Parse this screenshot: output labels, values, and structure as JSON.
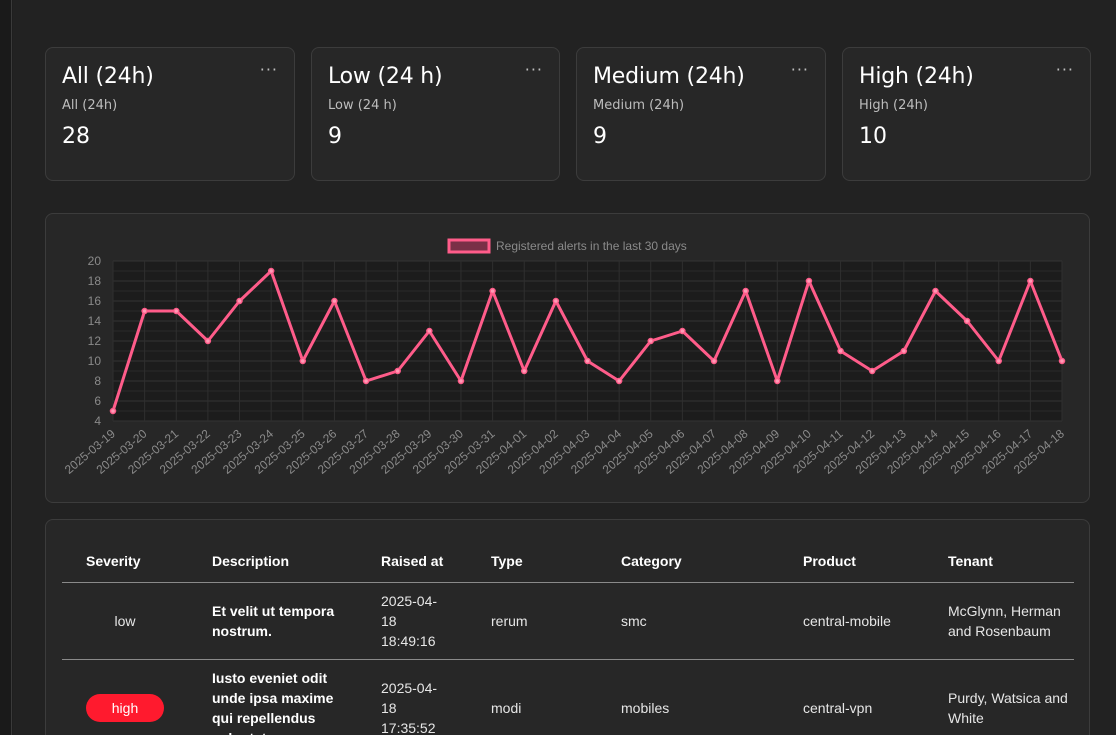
{
  "stats": [
    {
      "title": "All (24h)",
      "subtitle": "All (24h)",
      "value": "28"
    },
    {
      "title": "Low (24 h)",
      "subtitle": "Low (24 h)",
      "value": "9"
    },
    {
      "title": "Medium (24h)",
      "subtitle": "Medium (24h)",
      "value": "9"
    },
    {
      "title": "High (24h)",
      "subtitle": "High (24h)",
      "value": "10"
    }
  ],
  "menu_glyph": "···",
  "chart_data": {
    "type": "line",
    "legend_label": "Registered alerts in the last 30 days",
    "legend_placement": "top-center",
    "series_color": "#ff5c8a",
    "grid": true,
    "ylim": [
      4,
      20
    ],
    "yticks": [
      "20",
      "18",
      "16",
      "14",
      "12",
      "10",
      "8",
      "6",
      "4"
    ],
    "categories": [
      "2025-03-19",
      "2025-03-20",
      "2025-03-21",
      "2025-03-22",
      "2025-03-23",
      "2025-03-24",
      "2025-03-25",
      "2025-03-26",
      "2025-03-27",
      "2025-03-28",
      "2025-03-29",
      "2025-03-30",
      "2025-03-31",
      "2025-04-01",
      "2025-04-02",
      "2025-04-03",
      "2025-04-04",
      "2025-04-05",
      "2025-04-06",
      "2025-04-07",
      "2025-04-08",
      "2025-04-09",
      "2025-04-10",
      "2025-04-11",
      "2025-04-12",
      "2025-04-13",
      "2025-04-14",
      "2025-04-15",
      "2025-04-16",
      "2025-04-17",
      "2025-04-18"
    ],
    "values": [
      5,
      15,
      15,
      12,
      16,
      19,
      10,
      16,
      8,
      9,
      13,
      8,
      17,
      9,
      16,
      10,
      8,
      12,
      13,
      10,
      17,
      8,
      18,
      11,
      9,
      11,
      17,
      14,
      10,
      18,
      10
    ]
  },
  "table": {
    "headers": [
      "Severity",
      "Description",
      "Raised at",
      "Type",
      "Category",
      "Product",
      "Tenant"
    ],
    "rows": [
      {
        "severity": "low",
        "description": "Et velit ut tempora nostrum.",
        "raised_at": "2025-04-18 18:49:16",
        "type": "rerum",
        "category": "smc",
        "product": "central-mobile",
        "tenant": "McGlynn, Herman and Rosenbaum"
      },
      {
        "severity": "high",
        "description": "Iusto eveniet odit unde ipsa maxime qui repellendus voluptatem",
        "raised_at": "2025-04-18 17:35:52",
        "type": "modi",
        "category": "mobiles",
        "product": "central-vpn",
        "tenant": "Purdy, Watsica and White"
      }
    ]
  },
  "colors": {
    "accent": "#ff5c8a",
    "high_badge": "#ff1a2e"
  }
}
